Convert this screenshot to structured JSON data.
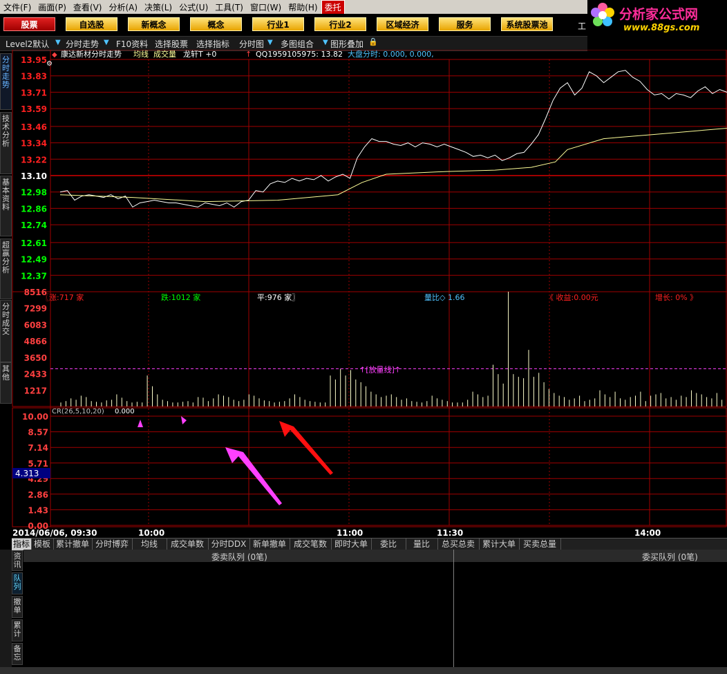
{
  "menu": [
    "文件(F)",
    "画面(P)",
    "查看(V)",
    "分析(A)",
    "决策(L)",
    "公式(U)",
    "工具(T)",
    "窗口(W)",
    "帮助(H)",
    "委托"
  ],
  "logo": {
    "title": "分析家公式网",
    "url": "www.88gs.com"
  },
  "nav": [
    "股票",
    "自选股",
    "新概念",
    "概念",
    "行业1",
    "行业2",
    "区域经济",
    "服务",
    "系统股票池"
  ],
  "nav_extra": "工",
  "toolbar": [
    "Level2默认",
    "分时走势",
    "F10资料",
    "选择股票",
    "选择指标",
    "分时图",
    "多图组合",
    "图形叠加"
  ],
  "left_tabs": [
    "分时走势",
    "技术分析",
    "基本资料",
    "超赢分析",
    "分时成交",
    "其他"
  ],
  "chart_header": {
    "stock": "康达新材分时走势",
    "avg": "均线",
    "vol": "成交量",
    "dragon": "龙轩T +0",
    "qq": "QQ1959105975: 13.82",
    "market": "大盘分时: 0.000, 0.000,"
  },
  "stats": {
    "up": "〖涨:717 家",
    "down": "跌:1012 家",
    "flat": "平:976 家〗",
    "ratio": "量比◇ 1.66",
    "income": "《 收益:0.00元",
    "growth": "增长: 0% 》",
    "vol_line": "↑[放量线]↑"
  },
  "indicator": {
    "label": "CR(26,5,10,20)",
    "value": "0.000",
    "cursor": "4.313"
  },
  "colors": {
    "red": "#ff2020",
    "green": "#00ff00",
    "price": "#ffffff",
    "avg": "#ffff99",
    "grid": "#a00000",
    "magenta": "#ff40ff"
  },
  "chart_data": {
    "type": "line",
    "price_ticks": [
      13.95,
      13.83,
      13.71,
      13.59,
      13.46,
      13.34,
      13.22,
      13.1,
      12.98,
      12.86,
      12.74,
      12.61,
      12.49,
      12.37
    ],
    "prev_close": 13.1,
    "vol_ticks": [
      8516,
      7299,
      6083,
      4866,
      3650,
      2433,
      1217
    ],
    "cr_ticks": [
      10.0,
      8.57,
      7.14,
      5.71,
      4.29,
      2.86,
      1.43,
      0.0
    ],
    "x_labels": [
      "2014/06/06, 09:30",
      "10:00",
      "11:00",
      "11:30",
      "14:00"
    ],
    "price_series": {
      "name": "分时走势",
      "points": [
        [
          0,
          12.98
        ],
        [
          3,
          12.99
        ],
        [
          6,
          12.92
        ],
        [
          9,
          12.95
        ],
        [
          12,
          12.96
        ],
        [
          15,
          12.95
        ],
        [
          18,
          12.94
        ],
        [
          21,
          12.96
        ],
        [
          24,
          12.93
        ],
        [
          27,
          12.95
        ],
        [
          30,
          12.87
        ],
        [
          33,
          12.9
        ],
        [
          36,
          12.91
        ],
        [
          39,
          12.92
        ],
        [
          42,
          12.91
        ],
        [
          45,
          12.9
        ],
        [
          48,
          12.9
        ],
        [
          51,
          12.89
        ],
        [
          54,
          12.88
        ],
        [
          57,
          12.87
        ],
        [
          60,
          12.9
        ],
        [
          63,
          12.89
        ],
        [
          66,
          12.88
        ],
        [
          69,
          12.9
        ],
        [
          72,
          12.87
        ],
        [
          75,
          12.91
        ],
        [
          78,
          12.92
        ],
        [
          81,
          12.99
        ],
        [
          84,
          12.98
        ],
        [
          87,
          13.04
        ],
        [
          90,
          13.06
        ],
        [
          93,
          13.05
        ],
        [
          96,
          13.08
        ],
        [
          99,
          13.06
        ],
        [
          102,
          13.08
        ],
        [
          105,
          13.07
        ],
        [
          108,
          13.1
        ],
        [
          111,
          13.06
        ],
        [
          114,
          13.09
        ],
        [
          117,
          13.11
        ],
        [
          120,
          13.08
        ],
        [
          123,
          13.23
        ],
        [
          126,
          13.31
        ],
        [
          129,
          13.37
        ],
        [
          132,
          13.35
        ],
        [
          135,
          13.35
        ],
        [
          138,
          13.33
        ],
        [
          141,
          13.32
        ],
        [
          144,
          13.34
        ],
        [
          147,
          13.31
        ],
        [
          150,
          13.34
        ],
        [
          153,
          13.33
        ],
        [
          156,
          13.31
        ],
        [
          159,
          13.33
        ],
        [
          162,
          13.31
        ],
        [
          165,
          13.29
        ],
        [
          168,
          13.27
        ],
        [
          171,
          13.24
        ],
        [
          174,
          13.25
        ],
        [
          177,
          13.23
        ],
        [
          180,
          13.25
        ],
        [
          183,
          13.21
        ],
        [
          186,
          13.23
        ],
        [
          189,
          13.26
        ],
        [
          192,
          13.27
        ],
        [
          195,
          13.33
        ],
        [
          198,
          13.4
        ],
        [
          201,
          13.52
        ],
        [
          204,
          13.65
        ],
        [
          207,
          13.74
        ],
        [
          210,
          13.78
        ],
        [
          213,
          13.69
        ],
        [
          216,
          13.74
        ],
        [
          219,
          13.86
        ],
        [
          222,
          13.83
        ],
        [
          225,
          13.78
        ],
        [
          228,
          13.82
        ],
        [
          231,
          13.86
        ],
        [
          234,
          13.87
        ],
        [
          237,
          13.82
        ],
        [
          240,
          13.79
        ],
        [
          243,
          13.73
        ],
        [
          246,
          13.69
        ],
        [
          249,
          13.7
        ],
        [
          252,
          13.66
        ],
        [
          255,
          13.7
        ],
        [
          258,
          13.69
        ],
        [
          261,
          13.67
        ],
        [
          264,
          13.72
        ],
        [
          267,
          13.75
        ],
        [
          270,
          13.7
        ],
        [
          273,
          13.73
        ],
        [
          276,
          13.71
        ],
        [
          279,
          13.74
        ],
        [
          282,
          13.77
        ],
        [
          285,
          13.79
        ]
      ]
    },
    "avg_series": {
      "name": "均线",
      "points": [
        [
          0,
          12.96
        ],
        [
          30,
          12.94
        ],
        [
          60,
          12.91
        ],
        [
          90,
          12.92
        ],
        [
          115,
          12.96
        ],
        [
          125,
          13.05
        ],
        [
          135,
          13.11
        ],
        [
          160,
          13.13
        ],
        [
          180,
          13.14
        ],
        [
          195,
          13.16
        ],
        [
          205,
          13.2
        ],
        [
          210,
          13.29
        ],
        [
          225,
          13.37
        ],
        [
          245,
          13.4
        ],
        [
          285,
          13.46
        ]
      ]
    },
    "volume": [
      300,
      400,
      600,
      500,
      800,
      700,
      400,
      350,
      300,
      450,
      500,
      900,
      650,
      400,
      300,
      350,
      300,
      2300,
      1500,
      900,
      500,
      400,
      300,
      300,
      350,
      400,
      300,
      700,
      650,
      400,
      600,
      900,
      800,
      700,
      500,
      400,
      500,
      900,
      800,
      600,
      450,
      400,
      300,
      350,
      400,
      600,
      900,
      700,
      500,
      400,
      350,
      300,
      300,
      2300,
      2000,
      2800,
      2300,
      2700,
      2000,
      1800,
      1500,
      1100,
      900,
      700,
      800,
      900,
      700,
      500,
      600,
      400,
      350,
      300,
      400,
      800,
      600,
      500,
      400,
      300,
      300,
      300,
      500,
      1100,
      900,
      700,
      800,
      3100,
      2400,
      1700,
      8516,
      2400,
      2200,
      2100,
      4200,
      2200,
      2500,
      1800,
      1300,
      1000,
      800,
      700,
      500,
      600,
      800,
      400,
      500,
      600,
      1200,
      900,
      700,
      1100,
      600,
      500,
      700,
      800,
      1100,
      400,
      800,
      900,
      1000,
      600,
      700,
      500,
      800,
      700,
      1200,
      1000,
      900,
      700,
      600,
      1000,
      500
    ]
  },
  "bottom_tabs": [
    "指标",
    "模板",
    "累计撤单",
    "分时博弈",
    "均线",
    "成交单数",
    "分时DDX",
    "新单撤单",
    "成交笔数",
    "即时大单",
    "委比",
    "量比",
    "总买总卖",
    "累计大单",
    "买卖总量"
  ],
  "queue": {
    "sell": "委卖队列 (0笔)",
    "buy": "委买队列 (0笔)"
  },
  "side_tabs": [
    "资讯",
    "队列",
    "撤单",
    "累计",
    "备忘"
  ]
}
